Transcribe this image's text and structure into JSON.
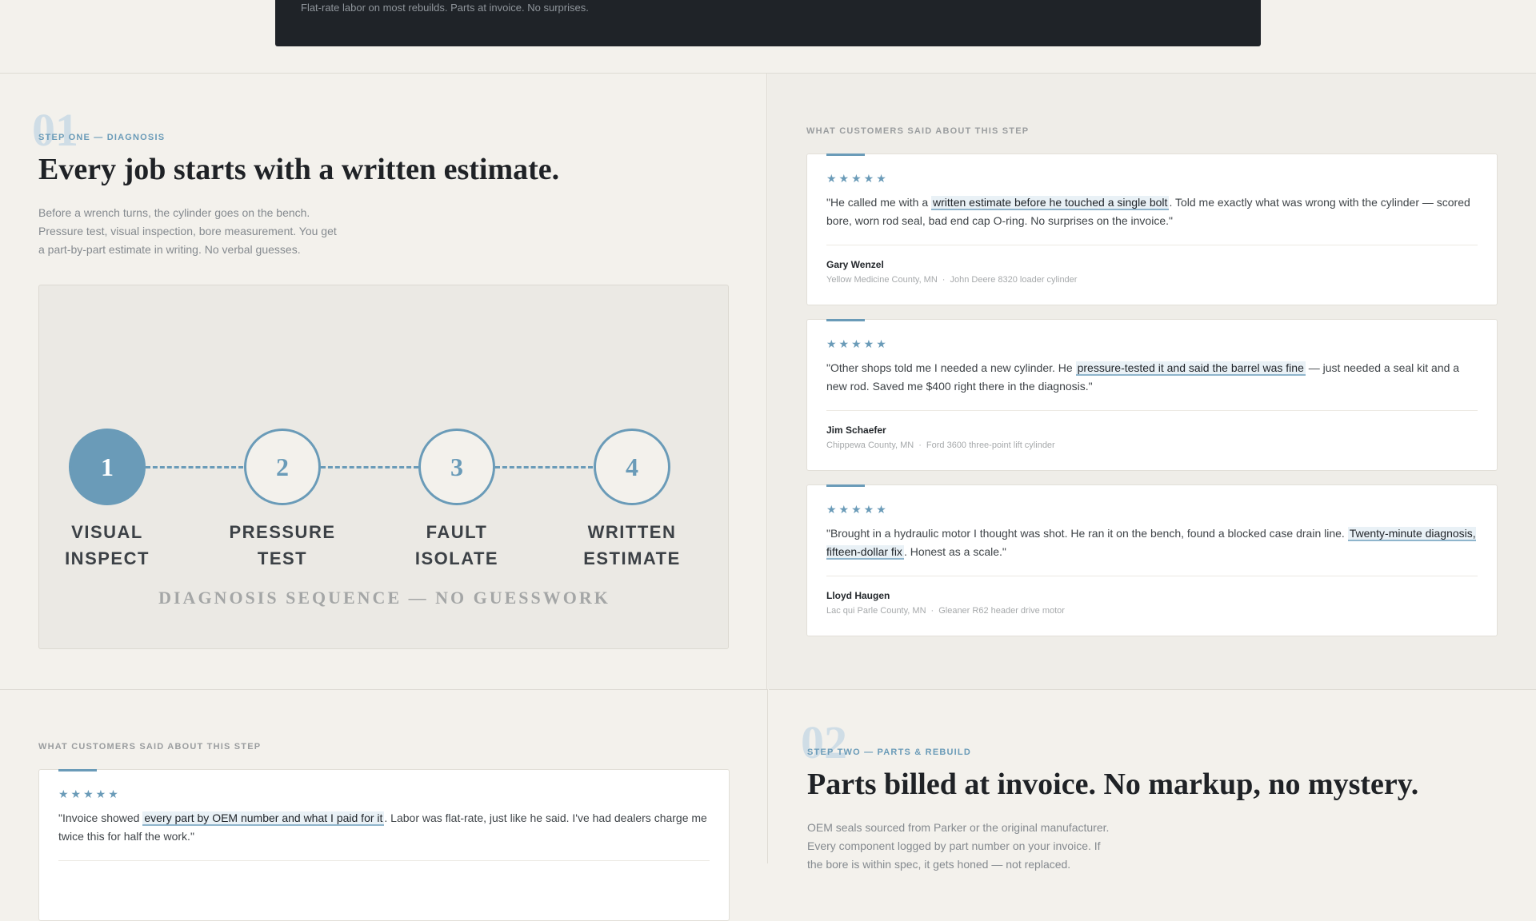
{
  "banner": {
    "tagline": "Flat-rate labor on most rebuilds. Parts at invoice. No surprises."
  },
  "step_one": {
    "number": "01",
    "eyebrow": "STEP ONE — DIAGNOSIS",
    "title": "Every job starts with a written estimate.",
    "body": [
      "Before a wrench turns, the cylinder goes on the bench.",
      "Pressure test, visual inspection, bore measurement. You get",
      "a part-by-part estimate in writing. No verbal guesses."
    ],
    "diagram": {
      "nodes": [
        {
          "num": "1",
          "line1": "VISUAL",
          "line2": "INSPECT",
          "active": true
        },
        {
          "num": "2",
          "line1": "PRESSURE",
          "line2": "TEST",
          "active": false
        },
        {
          "num": "3",
          "line1": "FAULT",
          "line2": "ISOLATE",
          "active": false
        },
        {
          "num": "4",
          "line1": "WRITTEN",
          "line2": "ESTIMATE",
          "active": false
        }
      ],
      "caption": "DIAGNOSIS SEQUENCE — NO GUESSWORK"
    }
  },
  "step_one_reviews": {
    "label": "WHAT CUSTOMERS SAID ABOUT THIS STEP",
    "stars": "★★★★★",
    "items": [
      {
        "pre": "\"He called me with a ",
        "highlight": "written estimate before he touched a single bolt",
        "post": ". Told me exactly what was wrong with the cylinder — scored bore, worn rod seal, bad end cap O-ring. No surprises on the invoice.\"",
        "name": "Gary Wenzel",
        "county": "Yellow Medicine County, MN",
        "sep": "·",
        "equipment": "John Deere 8320 loader cylinder"
      },
      {
        "pre": "\"Other shops told me I needed a new cylinder. He ",
        "highlight": "pressure-tested it and said the barrel was fine",
        "post": " — just needed a seal kit and a new rod. Saved me $400 right there in the diagnosis.\"",
        "name": "Jim Schaefer",
        "county": "Chippewa County, MN",
        "sep": "·",
        "equipment": "Ford 3600 three-point lift cylinder"
      },
      {
        "pre": "\"Brought in a hydraulic motor I thought was shot. He ran it on the bench, found a blocked case drain line. ",
        "highlight": "Twenty-minute diagnosis, fifteen-dollar fix",
        "post": ". Honest as a scale.\"",
        "name": "Lloyd Haugen",
        "county": "Lac qui Parle County, MN",
        "sep": "·",
        "equipment": "Gleaner R62 header drive motor"
      }
    ]
  },
  "step_two_reviews": {
    "label": "WHAT CUSTOMERS SAID ABOUT THIS STEP",
    "stars": "★★★★★",
    "items": [
      {
        "pre": "\"Invoice showed ",
        "highlight": "every part by OEM number and what I paid for it",
        "post": ". Labor was flat-rate, just like he said. I've had dealers charge me twice this for half the work.\""
      }
    ]
  },
  "step_two": {
    "number": "02",
    "eyebrow": "STEP TWO — PARTS & REBUILD",
    "title": "Parts billed at invoice. No markup, no mystery.",
    "body": [
      "OEM seals sourced from Parker or the original manufacturer.",
      "Every component logged by part number on your invoice. If",
      "the bore is within spec, it gets honed — not replaced."
    ]
  },
  "colors": {
    "accent": "#6a9bb8",
    "dark_banner": "#1f2328",
    "page_bg": "#f3f1ec"
  },
  "icons": {
    "star": "star-icon"
  }
}
